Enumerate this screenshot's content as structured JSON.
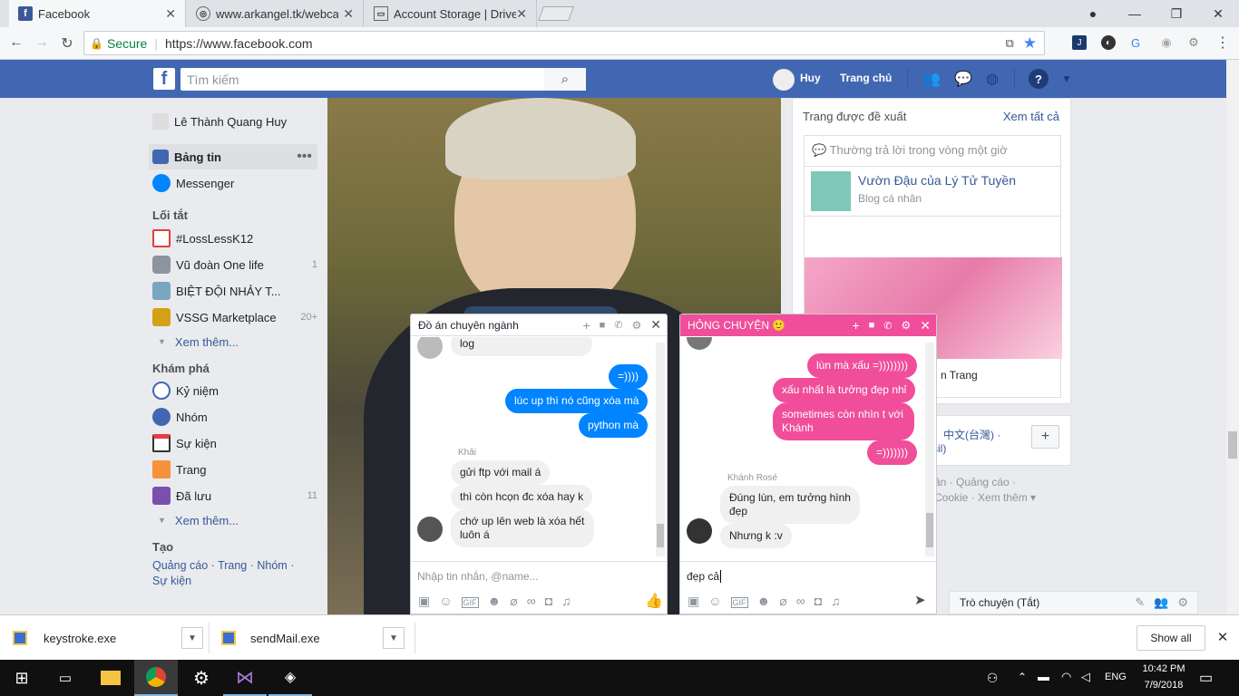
{
  "browser": {
    "tabs": [
      {
        "title": "Facebook"
      },
      {
        "title": "www.arkangel.tk/webcam"
      },
      {
        "title": "Account Storage | DriveH"
      }
    ],
    "secure_label": "Secure",
    "url": "https://www.facebook.com"
  },
  "header": {
    "search_placeholder": "Tìm kiếm",
    "user_name": "Huy",
    "home_label": "Trang chủ"
  },
  "left_nav": {
    "profile_name": "Lê Thành Quang Huy",
    "main_items": [
      {
        "label": "Bảng tin"
      },
      {
        "label": "Messenger"
      }
    ],
    "shortcuts_title": "Lối tắt",
    "shortcuts": [
      {
        "label": "#LossLessK12",
        "count": ""
      },
      {
        "label": "Vũ đoàn One life",
        "count": "1"
      },
      {
        "label": "BIỆT ĐỘI NHẢY T...",
        "count": ""
      },
      {
        "label": "VSSG Marketplace",
        "count": "20+"
      }
    ],
    "see_more": "Xem thêm...",
    "explore_title": "Khám phá",
    "explore": [
      {
        "label": "Kỷ niệm",
        "count": ""
      },
      {
        "label": "Nhóm",
        "count": ""
      },
      {
        "label": "Sự kiện",
        "count": ""
      },
      {
        "label": "Trang",
        "count": ""
      },
      {
        "label": "Đã lưu",
        "count": "11"
      }
    ],
    "create_title": "Tạo",
    "create_links": [
      "Quảng cáo",
      "Trang",
      "Nhóm",
      "Sự kiện"
    ]
  },
  "right": {
    "suggested_title": "Trang được đề xuất",
    "see_all": "Xem tất cả",
    "response_note": "Thường trả lời trong vòng một giờ",
    "page_name": "Vườn Đậu của Lý Tử Tuyền",
    "page_type": "Blog cá nhân",
    "partial_name": "n Trang",
    "lang_text": "中文(台灣) ·",
    "lang_partial": "sil)",
    "footer_line1": "ân · Quảng cáo ·",
    "footer_line2": "Cookie · Xem thêm ▾",
    "chat_bar": "Trò chuyện (Tắt)"
  },
  "chat1": {
    "title": "Đồ án chuyên ngành",
    "messages": [
      {
        "text": "log"
      },
      {
        "text": "=))))"
      },
      {
        "text": "lúc up thì nó cũng xóa mà"
      },
      {
        "text": "python mà"
      },
      {
        "text": "gửi ftp với mail á"
      },
      {
        "text": "thì còn hcọn đc xóa hay k"
      },
      {
        "text": "chớ up lên web là xóa hết luôn á"
      }
    ],
    "sender": "Khải",
    "input_placeholder": "Nhập tin nhắn, @name..."
  },
  "chat2": {
    "title": "HỎNG CHUYỆN 🙂",
    "messages": [
      {
        "text": "lùn mà xấu =))))))))"
      },
      {
        "text": "xấu nhất là tưởng đẹp nhỉ"
      },
      {
        "text": "sometimes còn nhìn t với Khánh"
      },
      {
        "text": "=)))))))"
      },
      {
        "text": "Đúng lùn, em tưởng hình đẹp"
      },
      {
        "text": "Nhưng k :v"
      }
    ],
    "sender": "Khánh Rosé",
    "input_value": "đẹp cả"
  },
  "downloads": {
    "items": [
      "keystroke.exe",
      "sendMail.exe"
    ],
    "show_all": "Show all"
  },
  "taskbar": {
    "lang": "ENG",
    "time": "10:42 PM",
    "date": "7/9/2018"
  },
  "colors": {
    "fb_blue": "#4267b2",
    "messenger_blue": "#0084ff",
    "pink": "#f04e9a"
  }
}
